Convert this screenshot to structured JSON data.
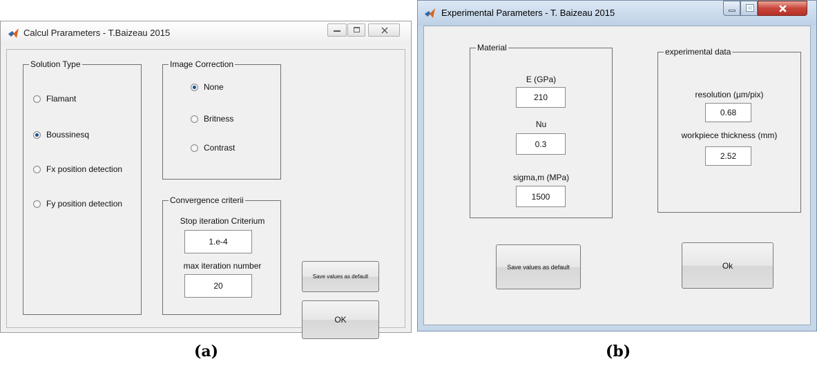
{
  "window_a": {
    "title": "Calcul Prarameters - T.Baizeau 2015",
    "solution_type": {
      "label": "Solution Type",
      "options": [
        "Flamant",
        "Boussinesq",
        "Fx position detection",
        "Fy position detection"
      ],
      "selected": "Boussinesq"
    },
    "image_correction": {
      "label": "Image Correction",
      "options": [
        "None",
        "Britness",
        "Contrast"
      ],
      "selected": "None"
    },
    "convergence": {
      "label": "Convergence criterii",
      "stop_label": "Stop iteration Criterium",
      "stop_value": "1.e-4",
      "max_label": "max iteration number",
      "max_value": "20"
    },
    "save_button": "Save values as default",
    "ok_button": "OK"
  },
  "window_b": {
    "title": "Experimental Parameters - T. Baizeau 2015",
    "material": {
      "label": "Material",
      "e_label": "E (GPa)",
      "e_value": "210",
      "nu_label": "Nu",
      "nu_value": "0.3",
      "sigma_label": "sigma,m (MPa)",
      "sigma_value": "1500"
    },
    "experimental": {
      "label": "experimental data",
      "resolution_label": "resolution (µm/pix)",
      "resolution_value": "0.68",
      "thickness_label": "workpiece thickness (mm)",
      "thickness_value": "2.52"
    },
    "save_button": "Save values as default",
    "ok_button": "Ok"
  },
  "captions": {
    "a": "(a)",
    "b": "(b)"
  },
  "colors": {
    "close_button_red": "#c9463d",
    "radio_dot": "#1f4e9c",
    "titlebar_b": "#c6d7ea"
  },
  "icons": {
    "app_icon": "matlab-icon"
  }
}
